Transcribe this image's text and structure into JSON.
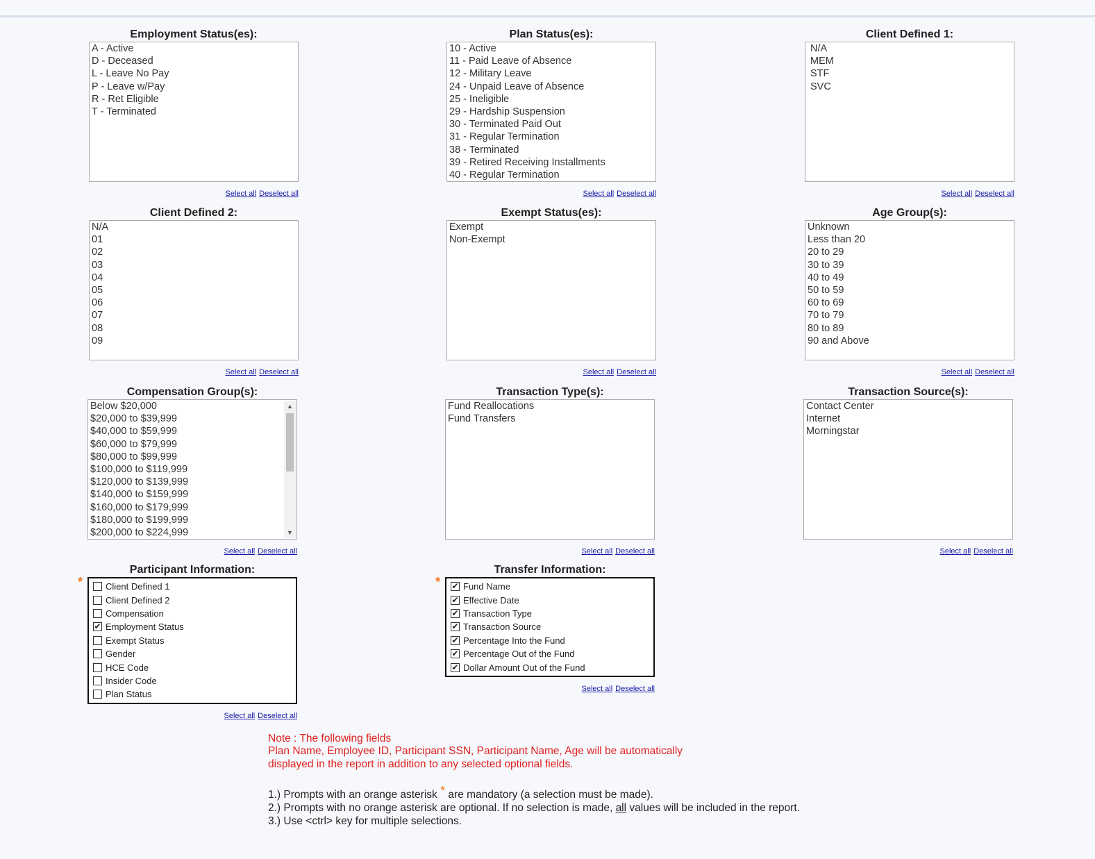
{
  "links": {
    "select_all": "Select all",
    "deselect_all": "Deselect all"
  },
  "panels": {
    "employment_status": {
      "title": "Employment Status(es):",
      "options": [
        "A - Active",
        "D - Deceased",
        "L - Leave No Pay",
        "P - Leave w/Pay",
        "R - Ret Eligible",
        "T - Terminated"
      ]
    },
    "plan_status": {
      "title": "Plan Status(es):",
      "options": [
        "10 - Active",
        "11 - Paid Leave of Absence",
        "12 - Military Leave",
        "24 - Unpaid Leave of Absence",
        "25 - Ineligible",
        "29 - Hardship Suspension",
        "30 - Terminated Paid Out",
        "31 - Regular Termination",
        "38 - Terminated",
        "39 - Retired Receiving Installments",
        "40 - Regular Termination"
      ]
    },
    "client_defined_1": {
      "title": "Client Defined 1:",
      "options": [
        "N/A",
        "MEM",
        "STF",
        "SVC"
      ]
    },
    "client_defined_2": {
      "title": "Client Defined 2:",
      "options": [
        "N/A",
        "01",
        "02",
        "03",
        "04",
        "05",
        "06",
        "07",
        "08",
        "09"
      ]
    },
    "exempt_status": {
      "title": "Exempt Status(es):",
      "options": [
        "Exempt",
        "Non-Exempt"
      ]
    },
    "age_group": {
      "title": "Age Group(s):",
      "options": [
        "Unknown",
        "Less than 20",
        "20 to 29",
        "30 to 39",
        "40 to 49",
        "50 to 59",
        "60 to 69",
        "70 to 79",
        "80 to 89",
        "90 and Above"
      ]
    },
    "compensation_group": {
      "title": "Compensation Group(s):",
      "options": [
        "Below $20,000",
        "$20,000 to $39,999",
        "$40,000 to $59,999",
        "$60,000 to $79,999",
        "$80,000 to $99,999",
        "$100,000 to $119,999",
        "$120,000 to $139,999",
        "$140,000 to $159,999",
        "$160,000 to $179,999",
        "$180,000 to $199,999",
        "$200,000 to $224,999"
      ]
    },
    "transaction_type": {
      "title": "Transaction Type(s):",
      "options": [
        "Fund Reallocations",
        "Fund Transfers"
      ]
    },
    "transaction_source": {
      "title": "Transaction Source(s):",
      "options": [
        "Contact Center",
        "Internet",
        "Morningstar"
      ]
    },
    "participant_information": {
      "title": "Participant Information:",
      "items": [
        {
          "label": "Client Defined 1",
          "checked": false
        },
        {
          "label": "Client Defined 2",
          "checked": false
        },
        {
          "label": "Compensation",
          "checked": false
        },
        {
          "label": "Employment Status",
          "checked": true
        },
        {
          "label": "Exempt Status",
          "checked": false
        },
        {
          "label": "Gender",
          "checked": false
        },
        {
          "label": "HCE Code",
          "checked": false
        },
        {
          "label": "Insider Code",
          "checked": false
        },
        {
          "label": "Plan Status",
          "checked": false
        }
      ]
    },
    "transfer_information": {
      "title": "Transfer Information:",
      "items": [
        {
          "label": "Fund Name",
          "checked": true
        },
        {
          "label": "Effective Date",
          "checked": true
        },
        {
          "label": "Transaction Type",
          "checked": true
        },
        {
          "label": "Transaction Source",
          "checked": true
        },
        {
          "label": "Percentage Into the Fund",
          "checked": true
        },
        {
          "label": "Percentage Out of the Fund",
          "checked": true
        },
        {
          "label": "Dollar Amount Out of the Fund",
          "checked": true
        }
      ]
    }
  },
  "asterisk": "*",
  "note": {
    "line1": "Note : The following fields",
    "line2": "Plan Name, Employee ID, Participant SSN, Participant Name, Age will be automatically",
    "line3": "displayed in the report in addition to any selected optional fields."
  },
  "instructions": {
    "line1_a": "1.) Prompts with an orange asterisk ",
    "line1_b": " are mandatory (a selection must be made).",
    "line2_a": "2.) Prompts with no orange asterisk are optional.   If no selection is made, ",
    "line2_u": "all",
    "line2_b": " values will be included in the report.",
    "line3": "3.) Use <ctrl> key for multiple selections."
  },
  "colors": {
    "note": "#e02020",
    "asterisk": "#f07820",
    "link": "#1a1aa6"
  }
}
